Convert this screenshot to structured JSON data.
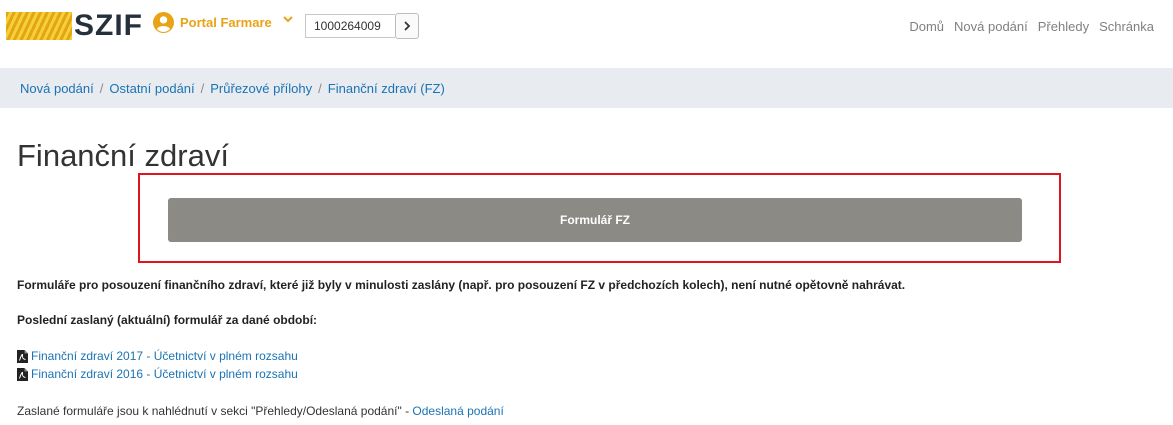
{
  "header": {
    "logo_text": "SZIF",
    "portal_name": "Portal Farmare",
    "client_id": "1000264009",
    "nav": [
      "Domů",
      "Nová podání",
      "Přehledy",
      "Schránka"
    ],
    "brand_color": "#e8a316",
    "icons": {
      "user": "user-circle-icon",
      "chevron": "chevron-down-icon",
      "go": "chevron-right-icon"
    }
  },
  "breadcrumb": [
    "Nová podání",
    "Ostatní podání",
    "Průřezové přílohy",
    "Finanční zdraví (FZ)"
  ],
  "main": {
    "title": "Finanční zdraví",
    "form_button": "Formulář FZ",
    "highlight_color": "#e0141e",
    "note": "Formuláře pro posouzení finančního zdraví, které již byly v minulosti zaslány (např. pro posouzení FZ v předchozích kolech), není nutné opětovně nahrávat.",
    "subheading": "Poslední zaslaný (aktuální) formulář za dané období:",
    "files": [
      "Finanční zdraví 2017 - Účetnictví v plném rozsahu",
      "Finanční zdraví 2016 - Účetnictví v plném rozsahu"
    ],
    "file_icon": "pdf-file-icon",
    "footer_text": "Zaslané formuláře jsou k nahlédnutí v sekci \"Přehledy/Odeslaná podání\" - ",
    "footer_link": "Odeslaná podání"
  }
}
